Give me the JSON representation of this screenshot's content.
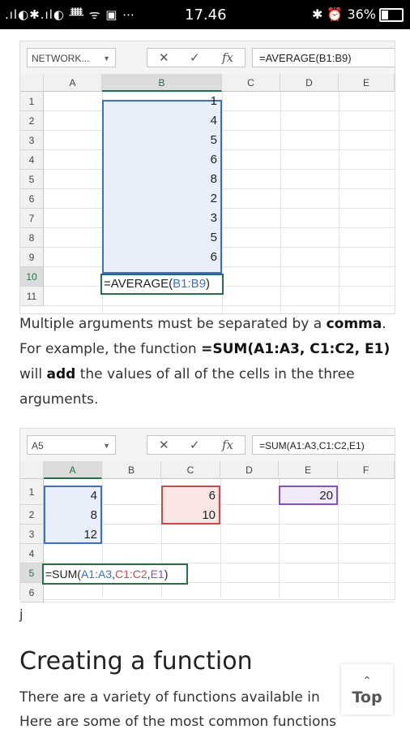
{
  "status_bar": {
    "signal": ".ıl◐✱.ıl◐ ᚙ ᯤ ▣ ⋯",
    "time": "17.46",
    "right": "✱ ⏰ 36%"
  },
  "sheet1": {
    "name_box": "NETWORK...",
    "formula": "=AVERAGE(B1:B9)",
    "columns": [
      "A",
      "B",
      "C",
      "D",
      "E"
    ],
    "rows": [
      "1",
      "2",
      "3",
      "4",
      "5",
      "6",
      "7",
      "8",
      "9",
      "10",
      "11"
    ],
    "values_b": [
      "1",
      "4",
      "5",
      "6",
      "8",
      "2",
      "3",
      "5",
      "6"
    ],
    "cell_b10_prefix": "=AVERAGE(",
    "cell_b10_ref": "B1:B9",
    "cell_b10_suffix": ")"
  },
  "paragraph": {
    "t1": "Multiple arguments must be separated by a ",
    "b1": "comma",
    "t2": ". For example, the function ",
    "b2": "=SUM(A1:A3, C1:C2, E1)",
    "t3": " will ",
    "b3": "add",
    "t4": " the values of all of the cells in the three arguments."
  },
  "sheet2": {
    "name_box": "A5",
    "formula": "=SUM(A1:A3,C1:C2,E1)",
    "columns": [
      "A",
      "B",
      "C",
      "D",
      "E",
      "F"
    ],
    "rows": [
      "1",
      "2",
      "3",
      "4",
      "5",
      "6"
    ],
    "values_a": [
      "4",
      "8",
      "12"
    ],
    "values_c": [
      "6",
      "10"
    ],
    "value_e1": "20",
    "a5_prefix": "=SUM(",
    "a5_ref1": "A1:A3",
    "a5_ref2": "C1:C2",
    "a5_ref3": "E1",
    "a5_suffix": ")",
    "comma": ","
  },
  "stray_text": "j",
  "heading": "Creating a function",
  "body_text_1": "There are a variety of functions available in",
  "body_text_2": "Here are some of the most common functions",
  "top_button": {
    "arrow": "⌃",
    "label": "Top"
  }
}
